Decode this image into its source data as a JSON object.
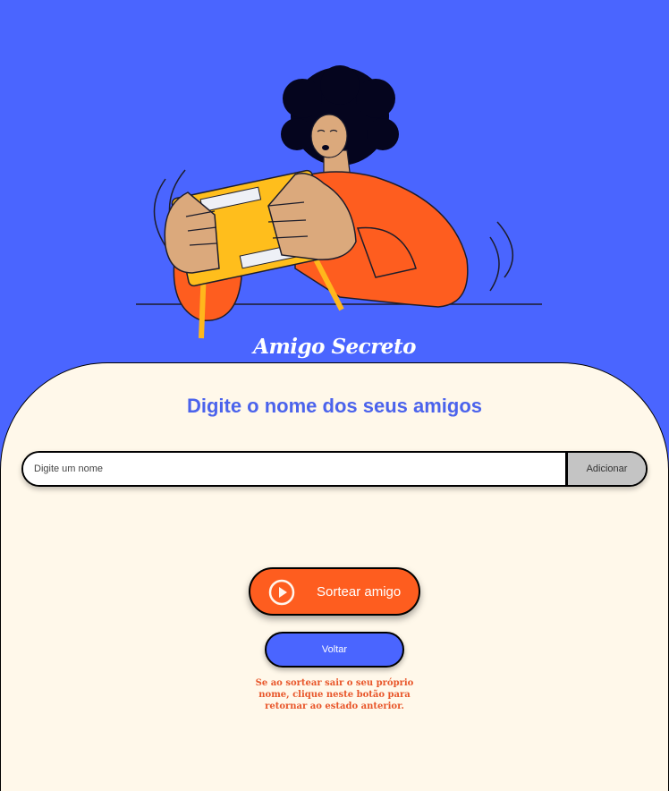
{
  "app": {
    "title": "Amigo Secreto"
  },
  "main": {
    "subtitle": "Digite o nome dos seus amigos",
    "name_input": {
      "placeholder": "Digite um nome",
      "value": ""
    },
    "add_label": "Adicionar",
    "draw_label": "Sortear amigo",
    "back_label": "Voltar",
    "hint": "Se ao sortear sair o seu próprio nome, clique neste botão para retornar ao estado anterior."
  },
  "icons": {
    "draw": "play-circle-icon"
  },
  "colors": {
    "background": "#4a65ff",
    "panel": "#fff8ea",
    "accent_orange": "#fe5d1f",
    "accent_blue": "#4b63ec",
    "button_gray": "#c4c4c4"
  }
}
